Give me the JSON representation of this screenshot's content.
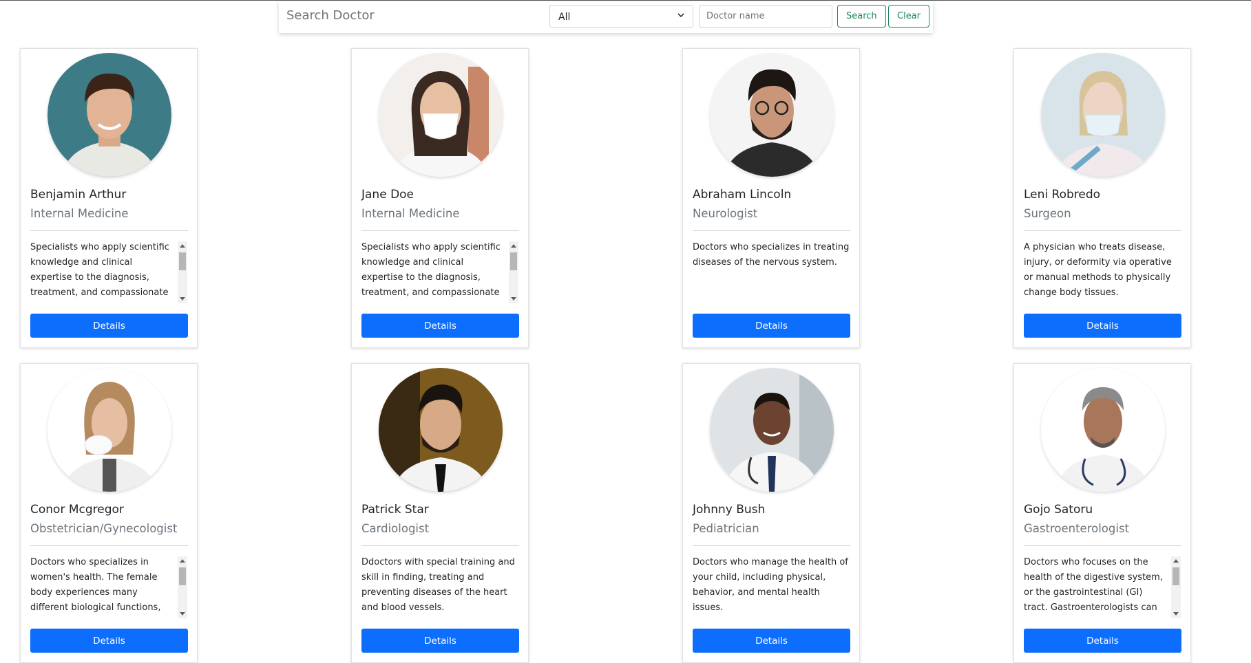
{
  "search": {
    "title": "Search Doctor",
    "filter_selected": "All",
    "name_placeholder": "Doctor name",
    "search_label": "Search",
    "clear_label": "Clear"
  },
  "doctors": [
    {
      "name": "Benjamin Arthur",
      "specialty": "Internal Medicine",
      "description": "Specialists who apply scientific knowledge and clinical expertise to the diagnosis, treatment, and compassionate care of adults across the spectrum from health to complex illness.",
      "button": "Details"
    },
    {
      "name": "Jane Doe",
      "specialty": "Internal Medicine",
      "description": "Specialists who apply scientific knowledge and clinical expertise to the diagnosis, treatment, and compassionate care of adults across the spectrum from health to complex illness.",
      "button": "Details"
    },
    {
      "name": "Abraham Lincoln",
      "specialty": "Neurologist",
      "description": "Doctors who specializes in treating diseases of the nervous system.",
      "button": "Details"
    },
    {
      "name": "Leni Robredo",
      "specialty": "Surgeon",
      "description": "A physician who treats disease, injury, or deformity via operative or manual methods to physically change body tissues.",
      "button": "Details"
    },
    {
      "name": "Conor Mcgregor",
      "specialty": "Obstetrician/Gynecologist",
      "description": "Doctors who specializes in women's health. The female body experiences many different biological functions, including menstruation, pregnancy and childbirth.",
      "button": "Details"
    },
    {
      "name": "Patrick Star",
      "specialty": "Cardiologist",
      "description": "Ddoctors with special training and skill in finding, treating and preventing diseases of the heart and blood vessels.",
      "button": "Details"
    },
    {
      "name": "Johnny Bush",
      "specialty": "Pediatrician",
      "description": "Doctors who manage the health of your child, including physical, behavior, and mental health issues.",
      "button": "Details"
    },
    {
      "name": "Gojo Satoru",
      "specialty": "Gastroenterologist",
      "description": "Doctors who focuses on the health of the digestive system, or the gastrointestinal (GI) tract. Gastroenterologists can treat all organs of the digestive system.",
      "button": "Details"
    }
  ],
  "colors": {
    "primary": "#0d6efd",
    "outline": "#198754",
    "muted": "#6c757d"
  }
}
